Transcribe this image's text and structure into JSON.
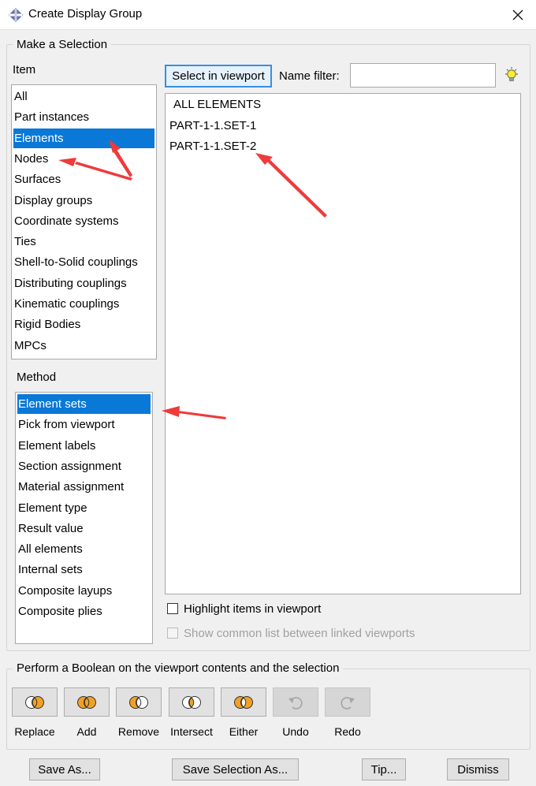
{
  "window": {
    "title": "Create Display Group",
    "icon": "abaqus-display-group-icon",
    "close_icon": "close-icon"
  },
  "selection_group": {
    "title": "Make a Selection"
  },
  "item": {
    "label": "Item",
    "items": [
      "All",
      "Part instances",
      "Elements",
      "Nodes",
      "Surfaces",
      "Display groups",
      "Coordinate systems",
      "Ties",
      "Shell-to-Solid couplings",
      "Distributing couplings",
      "Kinematic couplings",
      "Rigid Bodies",
      "MPCs"
    ],
    "selected": "Elements"
  },
  "method": {
    "label": "Method",
    "items": [
      "Element sets",
      "Pick from viewport",
      "Element labels",
      "Section assignment",
      "Material assignment",
      "Element type",
      "Result value",
      "All elements",
      "Internal sets",
      "Composite layups",
      "Composite plies"
    ],
    "selected": "Element sets"
  },
  "toolbar": {
    "select_in_viewport_label": "Select in viewport",
    "name_filter_label": "Name filter:",
    "name_filter_value": "",
    "bulb_icon": "lightbulb-icon"
  },
  "sets": {
    "items": [
      "ALL ELEMENTS",
      "PART-1-1.SET-1",
      "PART-1-1.SET-2"
    ]
  },
  "options": {
    "highlight_label": "Highlight items in viewport",
    "highlight_checked": false,
    "common_list_label": "Show common list between linked viewports",
    "common_list_checked": false,
    "common_list_enabled": false
  },
  "boolean_group": {
    "title": "Perform a Boolean on the viewport contents and the selection",
    "buttons": [
      {
        "label": "Replace",
        "icon": "replace-icon",
        "enabled": true
      },
      {
        "label": "Add",
        "icon": "add-union-icon",
        "enabled": true
      },
      {
        "label": "Remove",
        "icon": "remove-icon",
        "enabled": true
      },
      {
        "label": "Intersect",
        "icon": "intersect-icon",
        "enabled": true
      },
      {
        "label": "Either",
        "icon": "either-icon",
        "enabled": true
      },
      {
        "label": "Undo",
        "icon": "undo-icon",
        "enabled": false
      },
      {
        "label": "Redo",
        "icon": "redo-icon",
        "enabled": false
      }
    ]
  },
  "footer": {
    "save_as_label": "Save As...",
    "save_selection_as_label": "Save Selection As...",
    "tip_label": "Tip...",
    "dismiss_label": "Dismiss"
  },
  "colors": {
    "selection": "#0a78d7",
    "annotation_arrow": "#ee3b3b",
    "venn_orange": "#f2a024"
  }
}
